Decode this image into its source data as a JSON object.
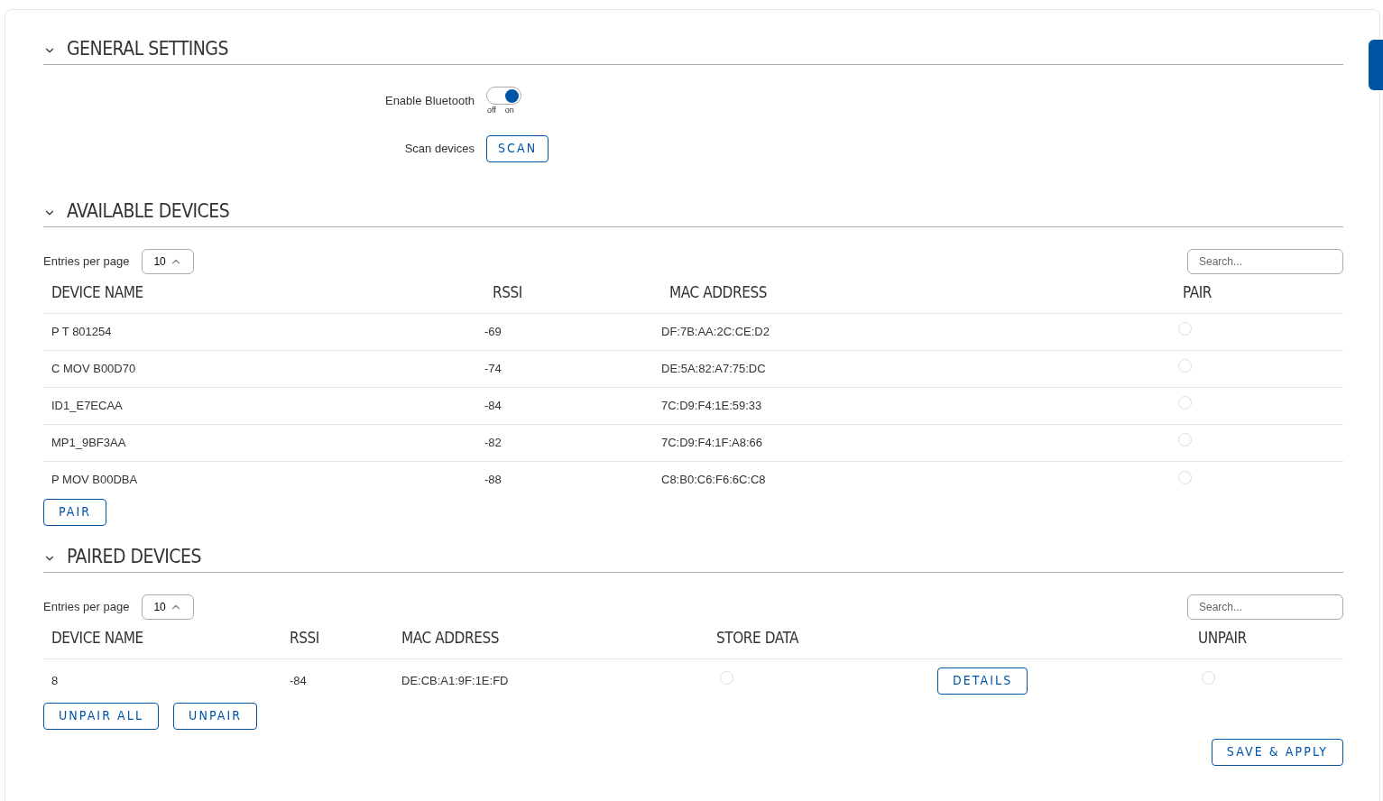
{
  "general_settings": {
    "title": "GENERAL SETTINGS",
    "expanded": true,
    "fields": [
      {
        "kind": "toggle",
        "label": "Enable Bluetooth",
        "on": true,
        "off_label": "off",
        "on_label": "on"
      },
      {
        "kind": "button",
        "label": "Scan devices",
        "button": "SCAN"
      }
    ]
  },
  "available_devices": {
    "title": "AVAILABLE DEVICES",
    "expanded": true,
    "entries_label": "Entries per page",
    "entries_value": "10",
    "search_placeholder": "Search...",
    "columns": [
      "DEVICE NAME",
      "RSSI",
      "MAC ADDRESS",
      "PAIR"
    ],
    "rows": [
      {
        "name": "P T 801254",
        "rssi": "-69",
        "mac": "DF:7B:AA:2C:CE:D2",
        "selected": false
      },
      {
        "name": "C MOV B00D70",
        "rssi": "-74",
        "mac": "DE:5A:82:A7:75:DC",
        "selected": false
      },
      {
        "name": "ID1_E7ECAA",
        "rssi": "-84",
        "mac": "7C:D9:F4:1E:59:33",
        "selected": false
      },
      {
        "name": "MP1_9BF3AA",
        "rssi": "-82",
        "mac": "7C:D9:F4:1F:A8:66",
        "selected": false
      },
      {
        "name": "P MOV B00DBA",
        "rssi": "-88",
        "mac": "C8:B0:C6:F6:6C:C8",
        "selected": false
      }
    ],
    "buttons": [
      "PAIR"
    ]
  },
  "paired_devices": {
    "title": "PAIRED DEVICES",
    "expanded": true,
    "entries_label": "Entries per page",
    "entries_value": "10",
    "search_placeholder": "Search...",
    "columns": [
      "DEVICE NAME",
      "RSSI",
      "MAC ADDRESS",
      "STORE DATA",
      "UNPAIR"
    ],
    "rows": [
      {
        "name": "8",
        "rssi": "-84",
        "mac": "DE:CB:A1:9F:1E:FD",
        "store_data": false,
        "details": "DETAILS",
        "selected": false
      }
    ],
    "buttons": [
      "UNPAIR ALL",
      "UNPAIR"
    ]
  },
  "save_button": "SAVE & APPLY"
}
